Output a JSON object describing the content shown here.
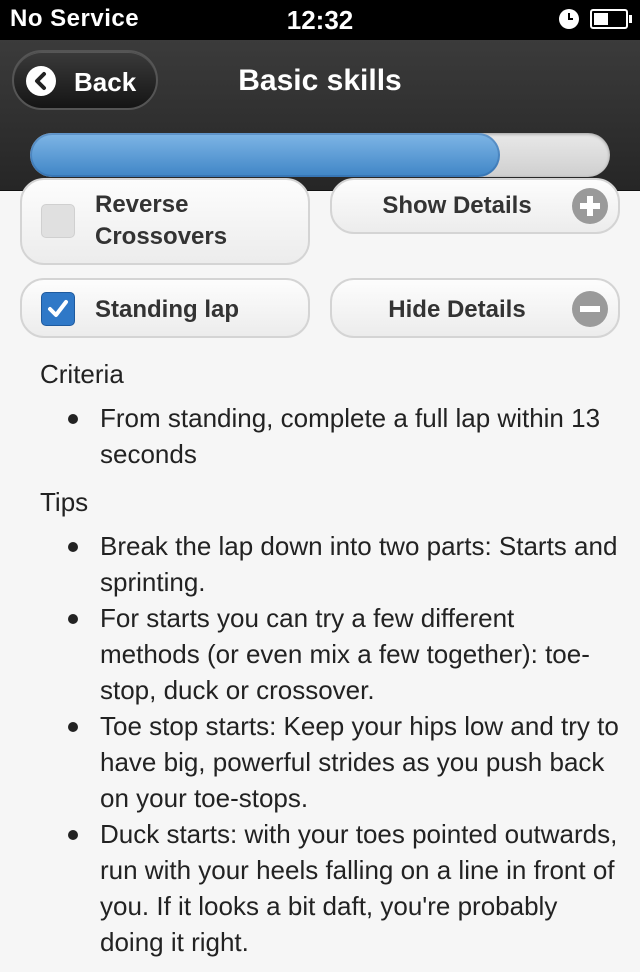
{
  "status_bar": {
    "carrier": "No Service",
    "time": "12:32",
    "icons": [
      "alarm-clock-icon",
      "battery-charging-icon"
    ]
  },
  "header": {
    "back_label": "Back",
    "title": "Basic skills",
    "progress_percent": 81
  },
  "skills": [
    {
      "label": "Reverse Crossovers",
      "checked": false,
      "details_label": "Show Details",
      "details_icon": "plus-icon"
    },
    {
      "label": "Standing lap",
      "checked": true,
      "details_label": "Hide Details",
      "details_icon": "minus-icon"
    }
  ],
  "details": {
    "criteria_title": "Criteria",
    "criteria": [
      "From standing, complete a full lap within 13 seconds"
    ],
    "tips_title": "Tips",
    "tips": [
      "Break the lap down into two parts: Starts and sprinting.",
      "For starts you can try a few different methods (or even mix a few together): toe-stop, duck or crossover.",
      "Toe stop starts: Keep your hips low and try to have big, powerful strides as you push back on your toe-stops.",
      "Duck starts: with your toes pointed outwards, run with your heels falling on a line in front of you. If it looks a bit daft, you're probably doing it right."
    ]
  },
  "colors": {
    "accent_blue": "#3f85c6",
    "header_bg": "#2e2e2e",
    "checkbox_checked": "#2f78c7"
  }
}
